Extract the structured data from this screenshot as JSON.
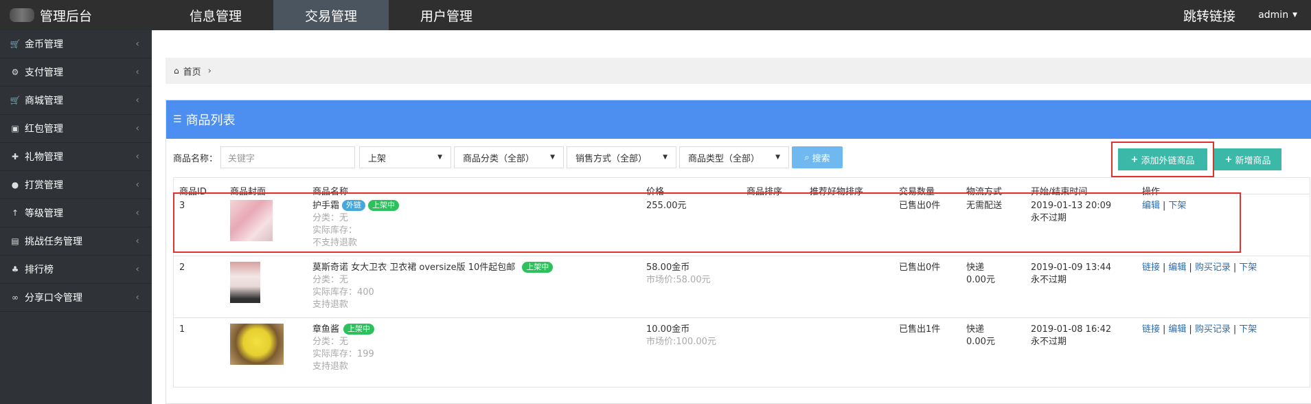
{
  "topbar": {
    "brand_title": "管理后台",
    "tabs": [
      {
        "label": "信息管理"
      },
      {
        "label": "交易管理"
      },
      {
        "label": "用户管理"
      }
    ],
    "jump_link": "跳转链接",
    "user": "admin"
  },
  "sidebar": {
    "items": [
      {
        "label": "金币管理",
        "icon": "cart-icon"
      },
      {
        "label": "支付管理",
        "icon": "gears-icon"
      },
      {
        "label": "商城管理",
        "icon": "cart-icon"
      },
      {
        "label": "红包管理",
        "icon": "briefcase-icon"
      },
      {
        "label": "礼物管理",
        "icon": "gift-icon"
      },
      {
        "label": "打赏管理",
        "icon": "users-icon"
      },
      {
        "label": "等级管理",
        "icon": "level-up-icon"
      },
      {
        "label": "挑战任务管理",
        "icon": "list-alt-icon"
      },
      {
        "label": "排行榜",
        "icon": "sitemap-icon"
      },
      {
        "label": "分享口令管理",
        "icon": "link-icon"
      }
    ]
  },
  "breadcrumb": {
    "home": "首页"
  },
  "panel": {
    "title": "商品列表",
    "filter": {
      "name_label": "商品名称：",
      "keyword_placeholder": "关键字",
      "status_value": "上架",
      "category_value": "商品分类（全部）",
      "sale_method_value": "销售方式（全部）",
      "type_value": "商品类型（全部）",
      "search_label": "搜索"
    },
    "add_external_label": "添加外链商品",
    "add_label": "新增商品",
    "columns": [
      "商品ID",
      "商品封面",
      "商品名称",
      "价格",
      "商品排序",
      "推荐好物排序",
      "交易数量",
      "物流方式",
      "开始/结束时间",
      "操作"
    ],
    "rows": [
      {
        "id": "3",
        "name": "护手霜",
        "tags": [
          {
            "text": "外链",
            "color": "blue"
          },
          {
            "text": "上架中",
            "color": "green"
          }
        ],
        "category": "分类：无",
        "stock": "实际库存：",
        "refund": "不支持退款",
        "price": "255.00元",
        "market_price": "",
        "trade": "已售出0件",
        "logistics": "无需配送",
        "logistics_fee": "",
        "start": "2019-01-13 20:09",
        "end": "永不过期",
        "actions": [
          "编辑",
          "下架"
        ]
      },
      {
        "id": "2",
        "name": "莫斯奇诺 女大卫衣 卫衣裙 oversize版 10件起包邮",
        "tags": [
          {
            "text": "上架中",
            "color": "green"
          }
        ],
        "category": "分类：无",
        "stock": "实际库存：400",
        "refund": "支持退款",
        "price": "58.00金币",
        "market_price": "市场价:58.00元",
        "trade": "已售出0件",
        "logistics": "快递",
        "logistics_fee": "0.00元",
        "start": "2019-01-09 13:44",
        "end": "永不过期",
        "actions": [
          "链接",
          "编辑",
          "购买记录",
          "下架"
        ]
      },
      {
        "id": "1",
        "name": "章鱼酱",
        "tags": [
          {
            "text": "上架中",
            "color": "green"
          }
        ],
        "category": "分类：无",
        "stock": "实际库存：199",
        "refund": "支持退款",
        "price": "10.00金币",
        "market_price": "市场价:100.00元",
        "trade": "已售出1件",
        "logistics": "快递",
        "logistics_fee": "0.00元",
        "start": "2019-01-08 16:42",
        "end": "永不过期",
        "actions": [
          "链接",
          "编辑",
          "购买记录",
          "下架"
        ]
      }
    ]
  },
  "colors": {
    "topbar": "#2f2f2f",
    "sidebar": "#2f3337",
    "panel_head": "#4d8ff0",
    "teal_button": "#3cb8a8",
    "highlight": "#e03030"
  }
}
